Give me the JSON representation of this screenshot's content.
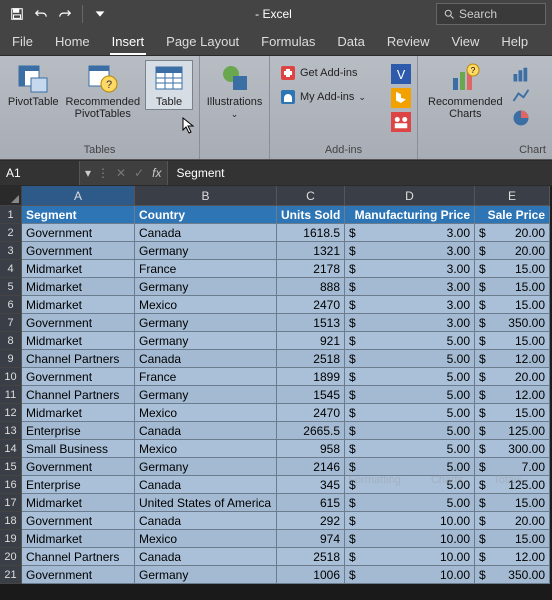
{
  "titlebar": {
    "title": "- Excel",
    "search_placeholder": "Search"
  },
  "tabs": [
    "File",
    "Home",
    "Insert",
    "Page Layout",
    "Formulas",
    "Data",
    "Review",
    "View",
    "Help"
  ],
  "active_tab": 2,
  "ribbon": {
    "groups": {
      "tables": {
        "label": "Tables",
        "pivot": "PivotTable",
        "recommended": "Recommended\nPivotTables",
        "table": "Table"
      },
      "illustrations": {
        "label": "",
        "btn": "Illustrations"
      },
      "addins": {
        "label": "Add-ins",
        "get": "Get Add-ins",
        "my": "My Add-ins"
      },
      "charts": {
        "label": "Chart",
        "rec": "Recommended\nCharts"
      }
    }
  },
  "namebox": "A1",
  "formula": "Segment",
  "columns": [
    "A",
    "B",
    "C",
    "D",
    "E"
  ],
  "headers": [
    "Segment",
    "Country",
    "Units Sold",
    "Manufacturing Price",
    "Sale Price"
  ],
  "rows": [
    {
      "seg": "Government",
      "country": "Canada",
      "units": "1618.5",
      "mp": "3.00",
      "sp": "20.00"
    },
    {
      "seg": "Government",
      "country": "Germany",
      "units": "1321",
      "mp": "3.00",
      "sp": "20.00"
    },
    {
      "seg": "Midmarket",
      "country": "France",
      "units": "2178",
      "mp": "3.00",
      "sp": "15.00"
    },
    {
      "seg": "Midmarket",
      "country": "Germany",
      "units": "888",
      "mp": "3.00",
      "sp": "15.00"
    },
    {
      "seg": "Midmarket",
      "country": "Mexico",
      "units": "2470",
      "mp": "3.00",
      "sp": "15.00"
    },
    {
      "seg": "Government",
      "country": "Germany",
      "units": "1513",
      "mp": "3.00",
      "sp": "350.00"
    },
    {
      "seg": "Midmarket",
      "country": "Germany",
      "units": "921",
      "mp": "5.00",
      "sp": "15.00"
    },
    {
      "seg": "Channel Partners",
      "country": "Canada",
      "units": "2518",
      "mp": "5.00",
      "sp": "12.00"
    },
    {
      "seg": "Government",
      "country": "France",
      "units": "1899",
      "mp": "5.00",
      "sp": "20.00"
    },
    {
      "seg": "Channel Partners",
      "country": "Germany",
      "units": "1545",
      "mp": "5.00",
      "sp": "12.00"
    },
    {
      "seg": "Midmarket",
      "country": "Mexico",
      "units": "2470",
      "mp": "5.00",
      "sp": "15.00"
    },
    {
      "seg": "Enterprise",
      "country": "Canada",
      "units": "2665.5",
      "mp": "5.00",
      "sp": "125.00"
    },
    {
      "seg": "Small Business",
      "country": "Mexico",
      "units": "958",
      "mp": "5.00",
      "sp": "300.00"
    },
    {
      "seg": "Government",
      "country": "Germany",
      "units": "2146",
      "mp": "5.00",
      "sp": "7.00"
    },
    {
      "seg": "Enterprise",
      "country": "Canada",
      "units": "345",
      "mp": "5.00",
      "sp": "125.00"
    },
    {
      "seg": "Midmarket",
      "country": "United States of America",
      "units": "615",
      "mp": "5.00",
      "sp": "15.00"
    },
    {
      "seg": "Government",
      "country": "Canada",
      "units": "292",
      "mp": "10.00",
      "sp": "20.00"
    },
    {
      "seg": "Midmarket",
      "country": "Mexico",
      "units": "974",
      "mp": "10.00",
      "sp": "15.00"
    },
    {
      "seg": "Channel Partners",
      "country": "Canada",
      "units": "2518",
      "mp": "10.00",
      "sp": "12.00"
    },
    {
      "seg": "Government",
      "country": "Germany",
      "units": "1006",
      "mp": "10.00",
      "sp": "350.00"
    }
  ],
  "watermark": [
    "Formatting",
    "Charts",
    "Totals"
  ]
}
